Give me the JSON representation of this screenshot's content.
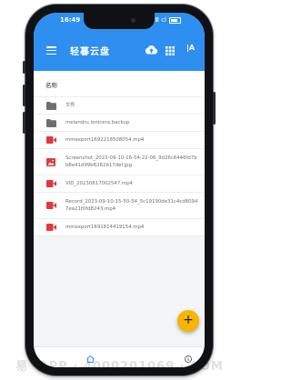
{
  "status": {
    "time": "16:49",
    "signal": "Ⅲ ⅽl"
  },
  "appbar": {
    "title": "轻暮云盘",
    "sort_label": "|A"
  },
  "list": {
    "header": "名称",
    "items": [
      {
        "type": "folder",
        "name": "文件"
      },
      {
        "type": "folder",
        "name": "melandru.lonicera.backup"
      },
      {
        "type": "video",
        "name": "mmexport1692218508054.mp4"
      },
      {
        "type": "image",
        "name": "Screenshot_2023-09-10-16-54-22-06_9d26c6446fd7bb8e41d99b6262b17def.jpg"
      },
      {
        "type": "video",
        "name": "VID_20230817002547.mp4"
      },
      {
        "type": "video",
        "name": "Record_2023-09-10-15-50-54_5c19190de31c4cd80947ea21f0fd8243.mp4"
      },
      {
        "type": "video",
        "name": "mmexport1691814419154.mp4"
      }
    ]
  },
  "fab": {
    "label": "+"
  },
  "bottomnav": {
    "home_label": "首页",
    "more_label": "更多"
  },
  "watermark": "易 ·APP · 4000201069 · COM",
  "colors": {
    "primary": "#2f8ff0",
    "fab": "#f7b500",
    "media_red": "#e0393e",
    "folder_grey": "#6f6f6f"
  }
}
